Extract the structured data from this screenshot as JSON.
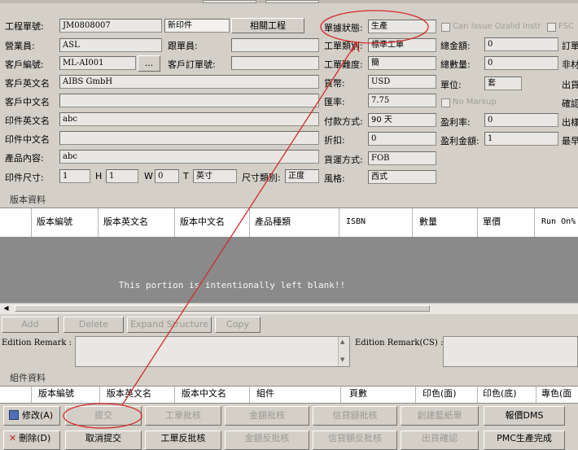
{
  "order": {
    "work_order_no_label": "工程單號:",
    "work_order_no": "JM0808007",
    "status_tag": "新印件",
    "related_button": "相關工程",
    "sales_label": "營業員:",
    "sales": "ASL",
    "follow_label": "跟單員:",
    "follow": "",
    "customer_code_label": "客戶編號:",
    "customer_code": "ML-AI001",
    "lookup_button": "...",
    "customer_order_label": "客戶訂單號:",
    "customer_order": "",
    "customer_en_label": "客戶英文名",
    "customer_en": "AIBS GmbH",
    "customer_cn_label": "客戶中文名",
    "customer_cn": "",
    "item_en_label": "印件英文名",
    "item_en": "abc",
    "item_cn_label": "印件中文名",
    "item_cn": "",
    "content_label": "產品內容:",
    "content": "abc",
    "size_label": "印件尺寸:",
    "size_value": "1",
    "h_label": "H",
    "h_value": "1",
    "w_label": "W",
    "w_value": "0",
    "t_label": "T",
    "unit": "英寸",
    "size_type_label": "尺寸類別:",
    "size_type": "正度"
  },
  "middle": {
    "doc_status_label": "單據狀態:",
    "doc_status": "生產",
    "work_type_label": "工單類別:",
    "work_type": "標準工單",
    "difficulty_label": "工單難度:",
    "difficulty": "簡",
    "currency_label": "貨幣:",
    "currency": "USD",
    "rate_label": "匯率:",
    "rate": "7.75",
    "payment_label": "付款方式:",
    "payment": "90 天",
    "discount_label": "折扣:",
    "discount": "0",
    "shipping_label": "貨運方式:",
    "shipping": "FOB",
    "style_label": "風格:",
    "style": "西式"
  },
  "right": {
    "can_issue_label": "Can Issue Ozalid Instr",
    "fsc_label": "FSC",
    "total_amount_label": "總金額:",
    "total_amount": "0",
    "total_qty_label": "總數量:",
    "total_qty": "0",
    "unit_label": "單位:",
    "unit": "套",
    "no_markup_label": "No Markup",
    "margin_rate_label": "盈利率:",
    "margin_rate": "0",
    "margin_amount_label": "盈利金額:",
    "margin_amount": "1",
    "edge_1": "訂單",
    "edge_2": "非材",
    "edge_3": "出貨",
    "edge_4": "確認",
    "edge_5": "出樣",
    "edge_6": "最早"
  },
  "edition": {
    "section_label": "版本資料",
    "columns": [
      "版本編號",
      "版本英文名",
      "版本中文名",
      "產品種類",
      "ISBN",
      "數量",
      "單價",
      "Run On%"
    ],
    "blank_text": "This portion is intentionally left blank!!",
    "buttons": [
      "Add",
      "Delete",
      "Expand Structure",
      "Copy"
    ],
    "remark_label": "Edition Remark :",
    "remark_cs_label": "Edition Remark(CS) :"
  },
  "components": {
    "section_label": "組件資料",
    "columns": [
      "版本編號",
      "版本英文名",
      "版本中文名",
      "組件",
      "頁數",
      "印色(面)",
      "印色(底)",
      "專色(面"
    ]
  },
  "actions": {
    "row1": [
      "修改(A)",
      "提交",
      "工單批核",
      "金額批核",
      "信貸額批核",
      "創建藍紙單",
      "報價DMS"
    ],
    "row2": [
      "刪除(D)",
      "取消提交",
      "工單反批核",
      "金額反批核",
      "信貸額反批核",
      "出貨確認",
      "PMC生產完成"
    ]
  },
  "annotation_color": "#d42a2a"
}
